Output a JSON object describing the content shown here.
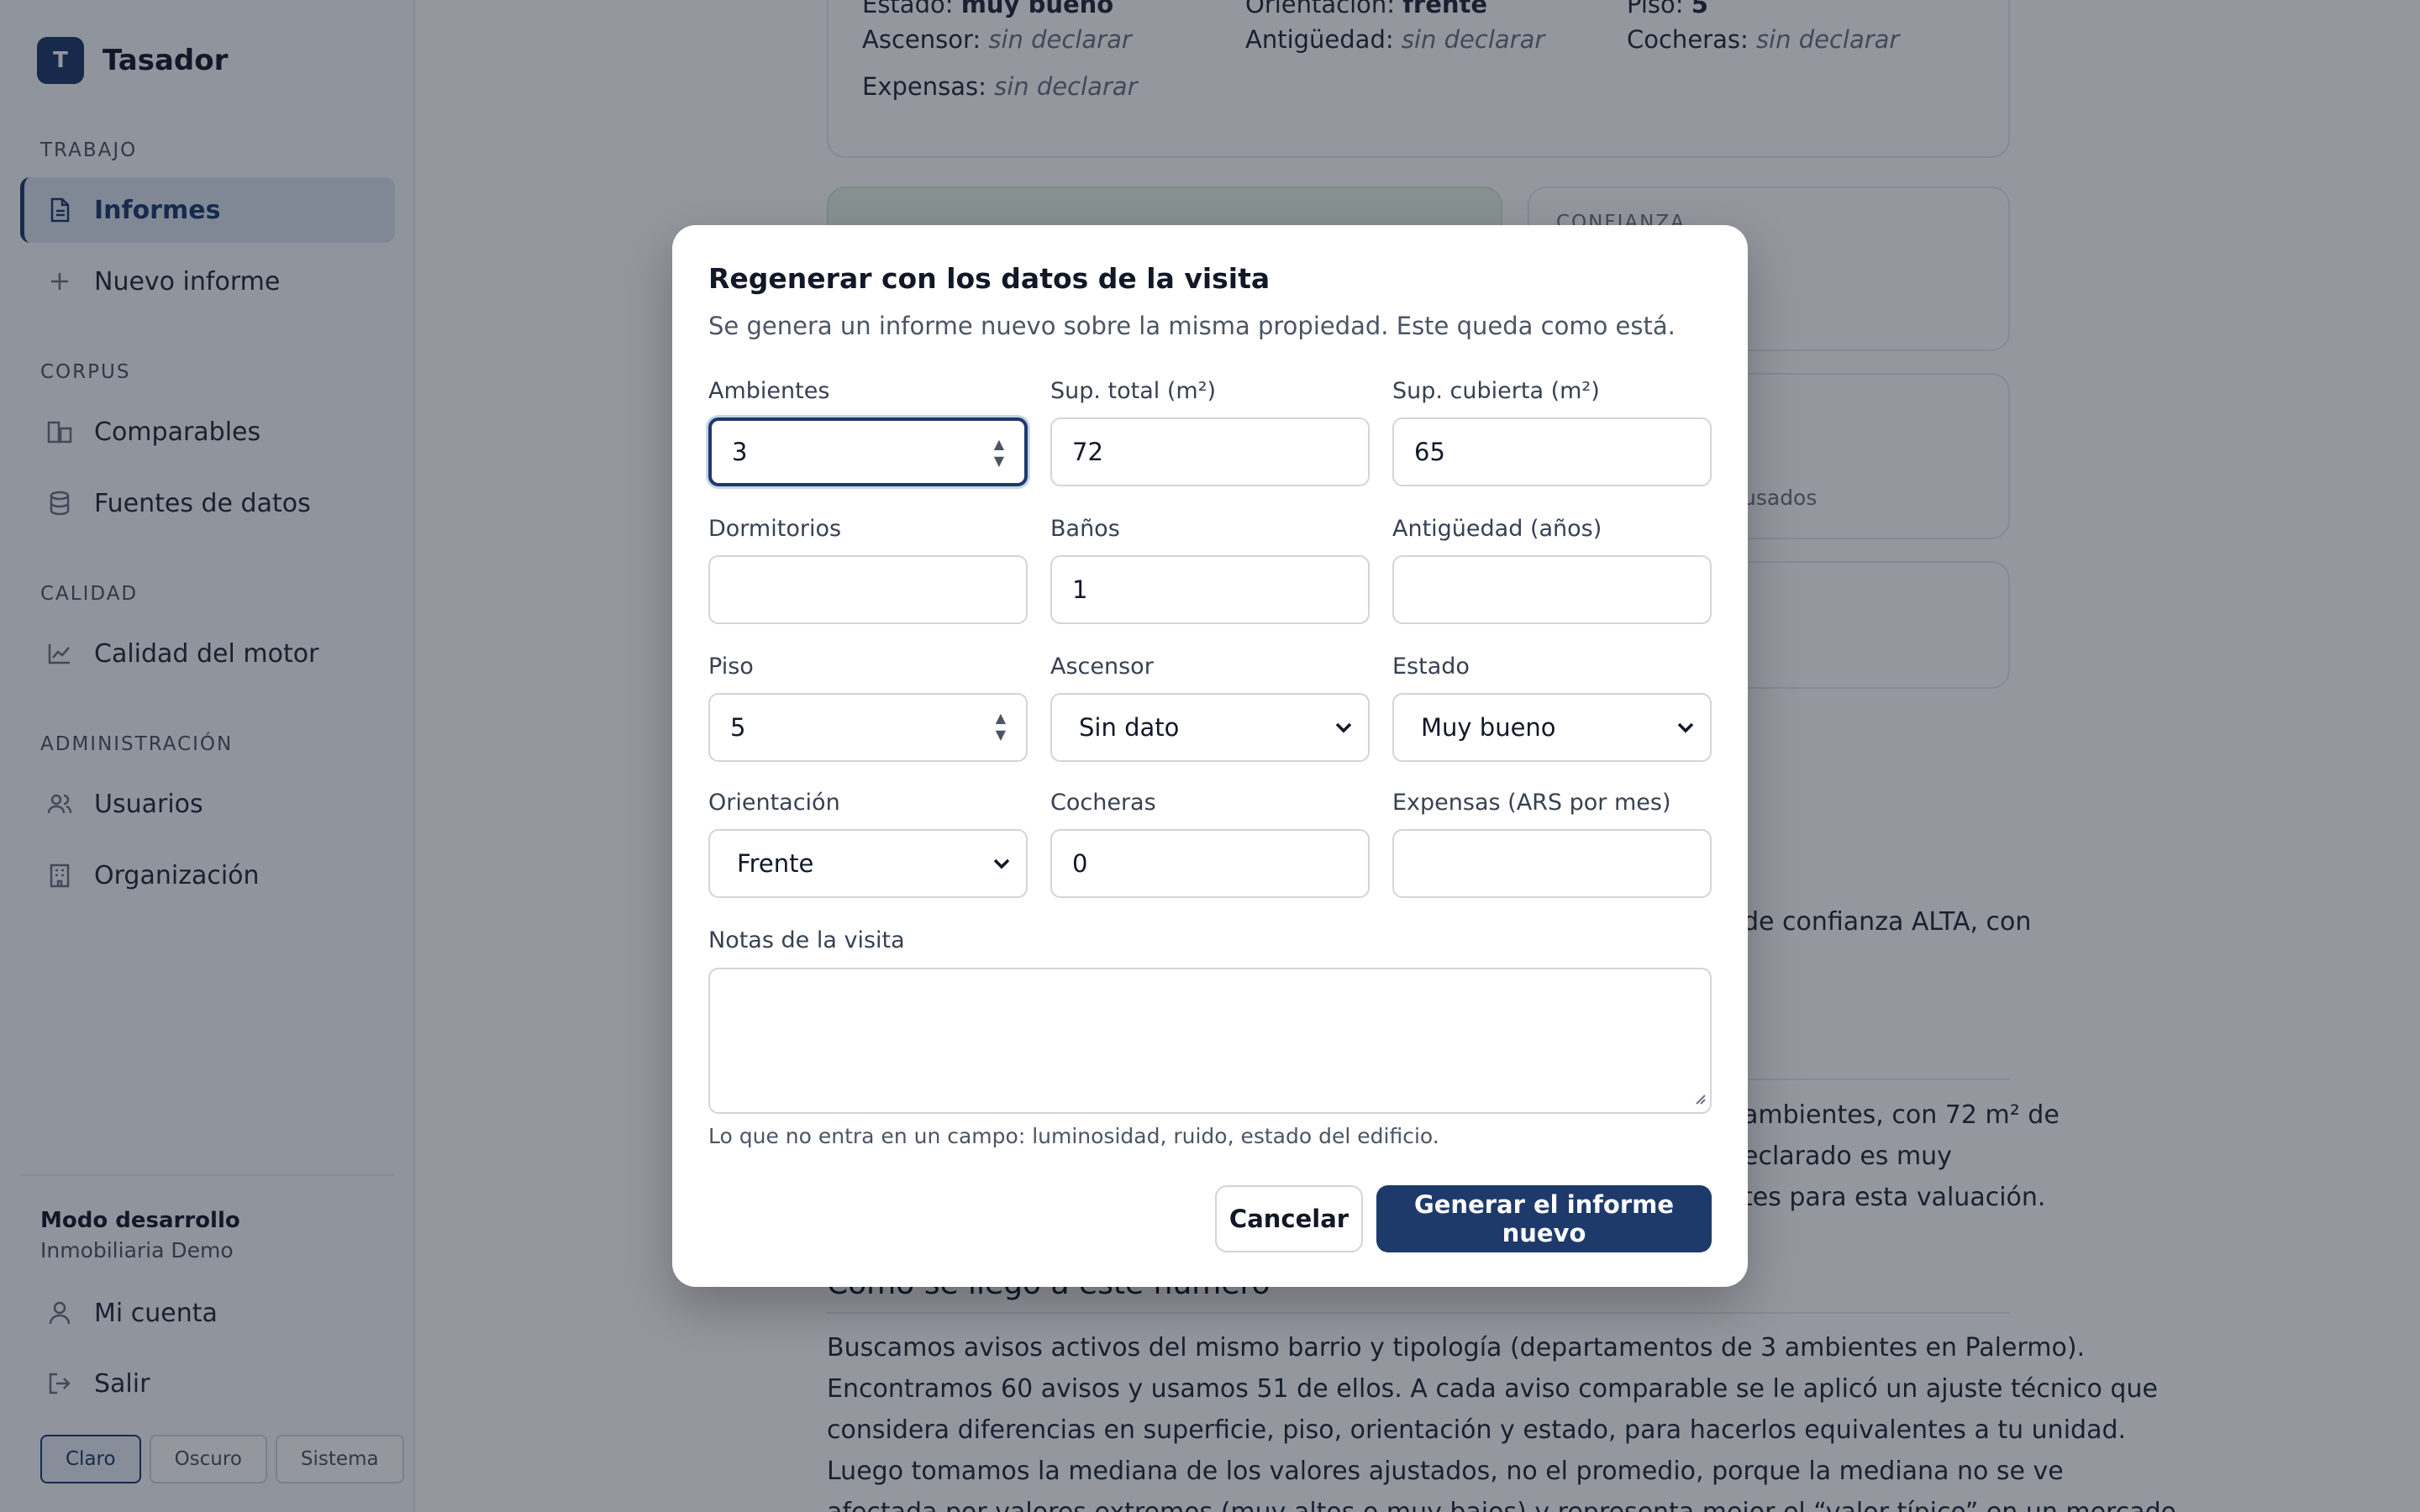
{
  "app": {
    "logo_letter": "T",
    "name": "Tasador"
  },
  "sidebar": {
    "sections": [
      {
        "label": "TRABAJO",
        "items": [
          {
            "label": "Informes",
            "icon": "document-icon",
            "active": true
          },
          {
            "label": "Nuevo informe",
            "icon": "plus-icon"
          }
        ]
      },
      {
        "label": "CORPUS",
        "items": [
          {
            "label": "Comparables",
            "icon": "buildings-icon"
          },
          {
            "label": "Fuentes de datos",
            "icon": "database-icon"
          }
        ]
      },
      {
        "label": "CALIDAD",
        "items": [
          {
            "label": "Calidad del motor",
            "icon": "chart-line-icon"
          }
        ]
      },
      {
        "label": "ADMINISTRACIÓN",
        "items": [
          {
            "label": "Usuarios",
            "icon": "users-icon"
          },
          {
            "label": "Organización",
            "icon": "building-icon"
          }
        ]
      }
    ],
    "footer": {
      "mode": "Modo desarrollo",
      "org": "Inmobiliaria Demo",
      "account": "Mi cuenta",
      "logout": "Salir",
      "theme": {
        "light": "Claro",
        "dark": "Oscuro",
        "system": "Sistema",
        "selected": "Claro"
      }
    }
  },
  "background": {
    "details": {
      "estado_label": "Estado:",
      "estado_value": "muy bueno",
      "orientacion_label": "Orientación:",
      "orientacion_value": "frente",
      "piso_label": "Piso:",
      "piso_value": "5",
      "ascensor_label": "Ascensor:",
      "antiguedad_label": "Antigüedad:",
      "cocheras_label": "Cocheras:",
      "expensas_label": "Expensas:",
      "undeclared": "sin declarar"
    },
    "confidence_label": "CONFIANZA",
    "used_fragment": "usados",
    "summary_fragment": "de confianza ALTA, con",
    "desc_line1": "ambientes, con 72 m² de",
    "desc_line2": "eclarado es muy",
    "desc_line3": "tes para esta valuación.",
    "section_heading": "Cómo se llegó a este número",
    "method_lines": [
      "Buscamos avisos activos del mismo barrio y tipología (departamentos de 3 ambientes en Palermo).",
      "Encontramos 60 avisos y usamos 51 de ellos. A cada aviso comparable se le aplicó un ajuste técnico que",
      "considera diferencias en superficie, piso, orientación y estado, para hacerlos equivalentes a tu unidad.",
      "Luego tomamos la mediana de los valores ajustados, no el promedio, porque la mediana no se ve",
      "afectada por valores extremos (muy altos o muy bajos) y representa mejor el “valor típico” en un mercado"
    ]
  },
  "modal": {
    "title": "Regenerar con los datos de la visita",
    "subtitle": "Se genera un informe nuevo sobre la misma propiedad. Este queda como está.",
    "fields": {
      "ambientes": {
        "label": "Ambientes",
        "value": "3"
      },
      "sup_total": {
        "label": "Sup. total (m²)",
        "value": "72"
      },
      "sup_cubierta": {
        "label": "Sup. cubierta (m²)",
        "value": "65"
      },
      "dormitorios": {
        "label": "Dormitorios",
        "value": ""
      },
      "banos": {
        "label": "Baños",
        "value": "1"
      },
      "antiguedad": {
        "label": "Antigüedad (años)",
        "value": ""
      },
      "piso": {
        "label": "Piso",
        "value": "5"
      },
      "ascensor": {
        "label": "Ascensor",
        "value": "Sin dato"
      },
      "estado": {
        "label": "Estado",
        "value": "Muy bueno"
      },
      "orientacion": {
        "label": "Orientación",
        "value": "Frente"
      },
      "cocheras": {
        "label": "Cocheras",
        "value": "0"
      },
      "expensas": {
        "label": "Expensas (ARS por mes)",
        "value": ""
      }
    },
    "notes": {
      "label": "Notas de la visita",
      "value": "",
      "hint": "Lo que no entra en un campo: luminosidad, ruido, estado del edificio."
    },
    "cancel_label": "Cancelar",
    "submit_label": "Generar el informe nuevo"
  }
}
